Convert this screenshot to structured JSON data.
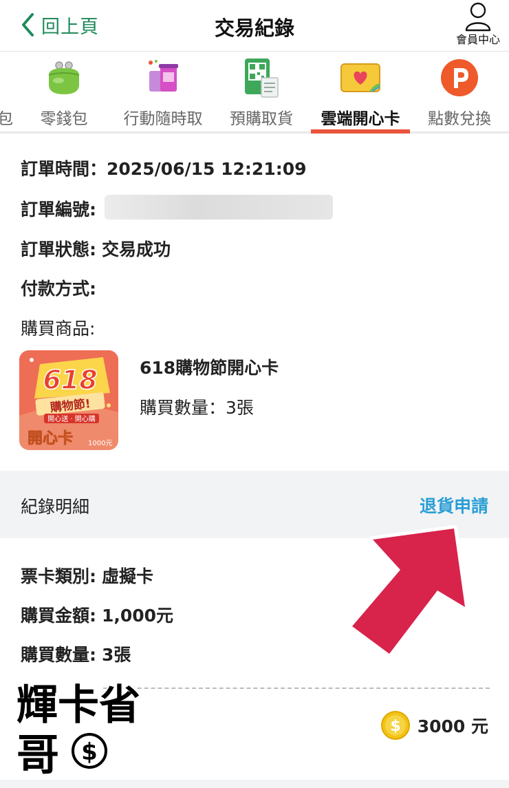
{
  "header": {
    "back_label": "回上頁",
    "title": "交易紀錄",
    "member_label": "會員中心"
  },
  "tabs": {
    "cut_label": "包",
    "items": [
      {
        "label": "零錢包"
      },
      {
        "label": "行動隨時取"
      },
      {
        "label": "預購取貨"
      },
      {
        "label": "雲端開心卡"
      },
      {
        "label": "點數兌換"
      }
    ]
  },
  "order": {
    "time_label": "訂單時間：",
    "time_value": "2025/06/15 12:21:09",
    "number_label": "訂單編號:",
    "status_label": "訂單狀態:",
    "status_value": "交易成功",
    "payment_label": "付款方式:",
    "products_label": "購買商品:"
  },
  "product": {
    "name": "618購物節開心卡",
    "qty": "購買數量：3張",
    "image_text": {
      "big": "618",
      "sub": "購物節!",
      "ribbon": "開心送 · 開心購",
      "card": "開心卡",
      "price": "1000元"
    }
  },
  "record": {
    "title": "紀錄明細",
    "refund_label": "退貨申請"
  },
  "details": {
    "type_label": "票卡類別:",
    "type_value": "虛擬卡",
    "amount_label": "購買金額:",
    "amount_value": "1,000元",
    "qty_label": "購買數量:",
    "qty_value": "3張",
    "total": "3000 元"
  },
  "watermark": {
    "line1": "輝卡省",
    "line2": "哥"
  },
  "colors": {
    "accent_green": "#1e8a5a",
    "tab_active_bar": "#e8543c",
    "refund_blue": "#2a9fd6",
    "arrow_red": "#d8234b"
  }
}
